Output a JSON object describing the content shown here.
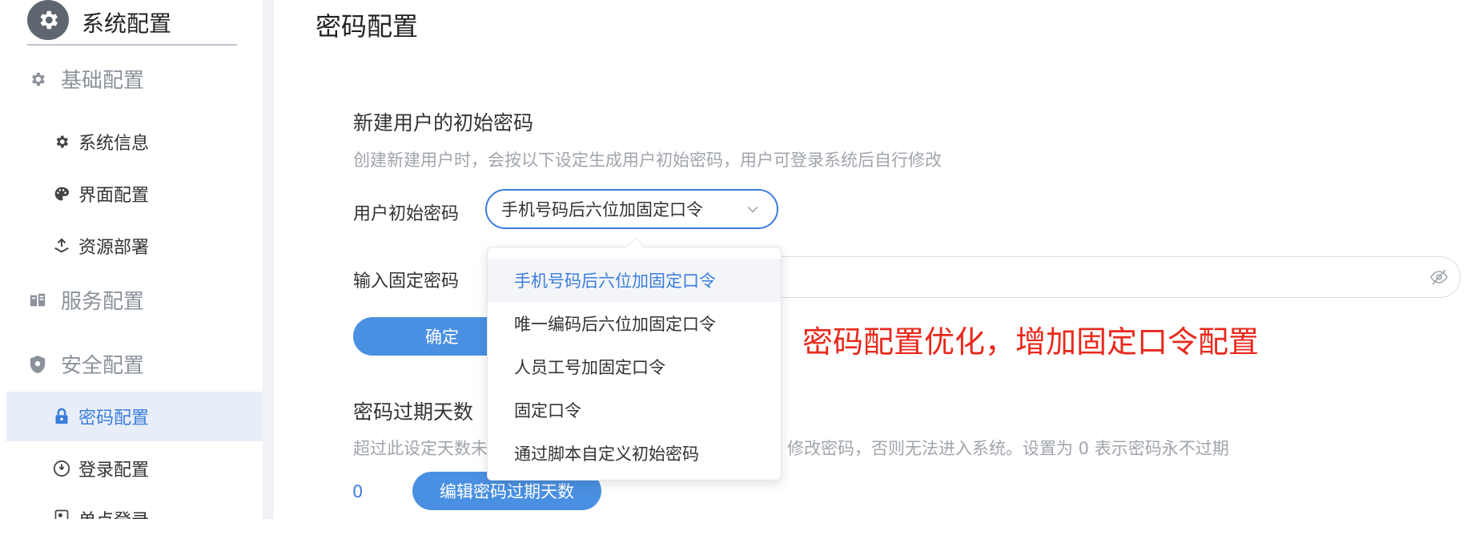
{
  "sidebar": {
    "header_title": "系统配置",
    "groups": {
      "basic": "基础配置",
      "service": "服务配置",
      "security": "安全配置"
    },
    "items": {
      "system_info": "系统信息",
      "ui_config": "界面配置",
      "resource_deploy": "资源部署",
      "password_config": "密码配置",
      "login_config": "登录配置",
      "sso": "单点登录"
    }
  },
  "main": {
    "page_title": "密码配置",
    "initial_password": {
      "section_title": "新建用户的初始密码",
      "description": "创建新建用户时，会按以下设定生成用户初始密码，用户可登录系统后自行修改",
      "label": "用户初始密码",
      "selected_value": "手机号码后六位加固定口令",
      "fixed_password_label": "输入固定密码",
      "confirm_label": "确定"
    },
    "expiry": {
      "section_title": "密码过期天数",
      "description_start": "超过此设定天数未",
      "description_end": "修改密码，否则无法进入系统。设置为 0 表示密码永不过期",
      "value": "0",
      "edit_label": "编辑密码过期天数"
    }
  },
  "dropdown": {
    "options": [
      "手机号码后六位加固定口令",
      "唯一编码后六位加固定口令",
      "人员工号加固定口令",
      "固定口令",
      "通过脚本自定义初始密码"
    ],
    "selected_index": 0
  },
  "annotation": "密码配置优化，增加固定口令配置",
  "colors": {
    "accent": "#3b7ddd",
    "button": "#4a90e2",
    "annotation": "#e8291c",
    "active_bg": "#e8eef7"
  }
}
